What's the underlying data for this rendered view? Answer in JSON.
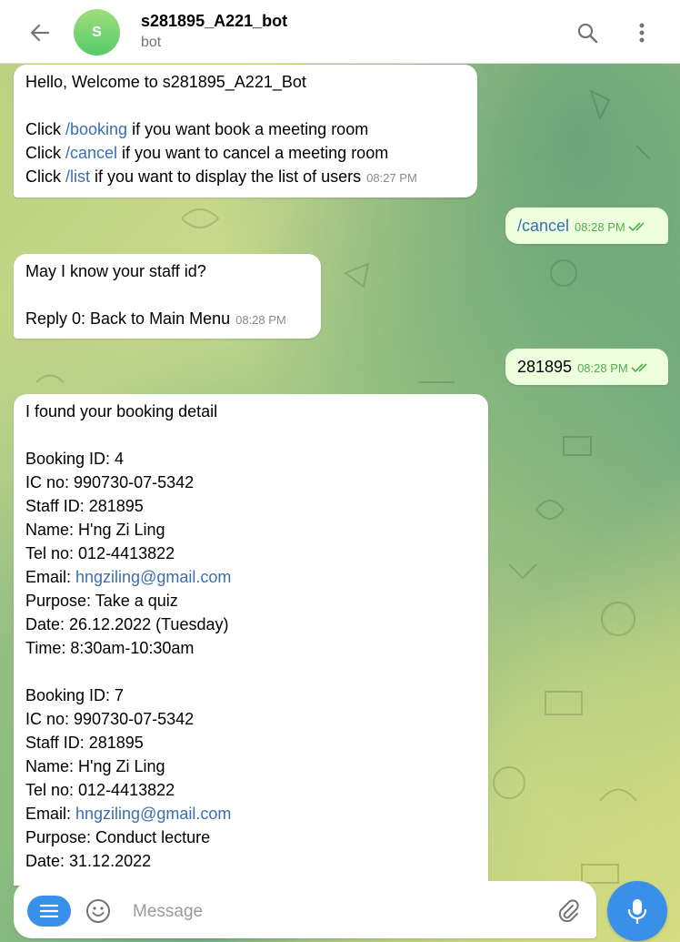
{
  "header": {
    "avatar_letter": "S",
    "title": "s281895_A221_bot",
    "subtitle": "bot",
    "icons": [
      "back-arrow-icon",
      "search-icon",
      "more-vertical-icon"
    ]
  },
  "messages": {
    "m1": {
      "greeting": "Hello, Welcome to s281895_A221_Bot",
      "l2_pre": "Click ",
      "l2_cmd": "/booking",
      "l2_post": " if you want book a meeting room",
      "l3_pre": "Click ",
      "l3_cmd": "/cancel",
      "l3_post": " if you want to cancel a meeting room",
      "l4_pre": "Click ",
      "l4_cmd": "/list",
      "l4_post": " if you want to display the list of users",
      "time": "08:27 PM"
    },
    "m2": {
      "cmd": "/cancel",
      "time": "08:28 PM"
    },
    "m3": {
      "line1": "May I know your staff id?",
      "line2": "Reply 0: Back to Main Menu",
      "time": "08:28 PM"
    },
    "m4": {
      "text": "281895",
      "time": "08:28 PM"
    },
    "m5": {
      "intro": "I found your booking detail",
      "bookings": [
        {
          "booking_id": "Booking ID: 4",
          "ic": "IC no: 990730-07-5342",
          "staff": "Staff ID: 281895",
          "name": "Name: H'ng Zi Ling",
          "tel": "Tel no: 012-4413822",
          "email_label": "Email: ",
          "email": "hngziling@gmail.com",
          "purpose": "Purpose: Take a quiz",
          "date": "Date: 26.12.2022 (Tuesday)",
          "time": "Time: 8:30am-10:30am"
        },
        {
          "booking_id": "Booking ID: 7",
          "ic": "IC no: 990730-07-5342",
          "staff": "Staff ID: 281895",
          "name": "Name: H'ng Zi Ling",
          "tel": "Tel no: 012-4413822",
          "email_label": "Email: ",
          "email": "hngziling@gmail.com",
          "purpose": "Purpose: Conduct lecture",
          "date": "Date: 31.12.2022"
        }
      ]
    }
  },
  "composer": {
    "placeholder": "Message",
    "icons": [
      "menu-icon",
      "emoji-icon",
      "attach-icon",
      "microphone-icon"
    ]
  },
  "colors": {
    "accent": "#3a90e8",
    "link": "#3a6fb0",
    "outgoing_bubble": "#eeffde",
    "read_ticks": "#4fae4e"
  }
}
